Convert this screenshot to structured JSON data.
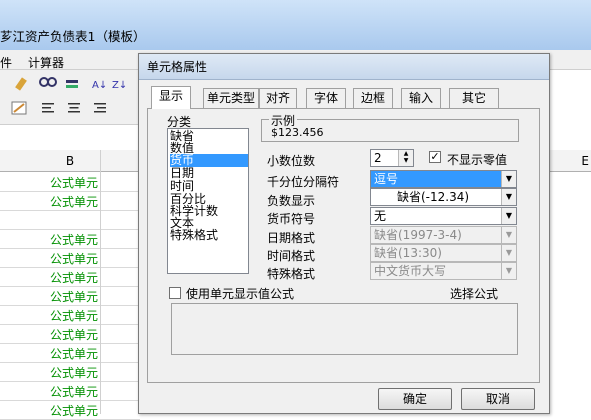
{
  "app": {
    "doc_title": "芗江资产负债表1（模板）",
    "menus": [
      "件",
      "计算器"
    ],
    "column_header": "B",
    "column_header_right": "E",
    "cells": [
      "公式单元",
      "公式单元",
      "",
      "公式单元",
      "公式单元",
      "公式单元",
      "公式单元",
      "公式单元",
      "公式单元",
      "公式单元",
      "公式单元",
      "公式单元",
      "公式单元"
    ]
  },
  "dialog": {
    "title": "单元格属性",
    "tabs": [
      "显示",
      "单元类型",
      "对齐",
      "字体",
      "边框",
      "输入",
      "其它"
    ],
    "active_tab": "显示",
    "category_label": "分类",
    "categories": [
      "缺省",
      "数值",
      "货币",
      "日期",
      "时间",
      "百分比",
      "科学计数",
      "文本",
      "特殊格式"
    ],
    "selected_category": "货币",
    "sample_label": "示例",
    "sample_value": "$123.456",
    "decimal_label": "小数位数",
    "decimal_value": "2",
    "hide_zero_label": "不显示零值",
    "hide_zero_checked": true,
    "thousands_label": "千分位分隔符",
    "thousands_value": "逗号",
    "negative_label": "负数显示",
    "negative_value": "缺省(-12.34)",
    "currency_label": "货币符号",
    "currency_value": "无",
    "date_label": "日期格式",
    "date_value": "缺省(1997-3-4)",
    "time_label": "时间格式",
    "time_value": "缺省(13:30)",
    "special_label": "特殊格式",
    "special_value": "中文货币大写",
    "use_formula_label": "使用单元显示值公式",
    "use_formula_checked": false,
    "choose_formula_label": "选择公式",
    "ok_label": "确定",
    "cancel_label": "取消"
  }
}
